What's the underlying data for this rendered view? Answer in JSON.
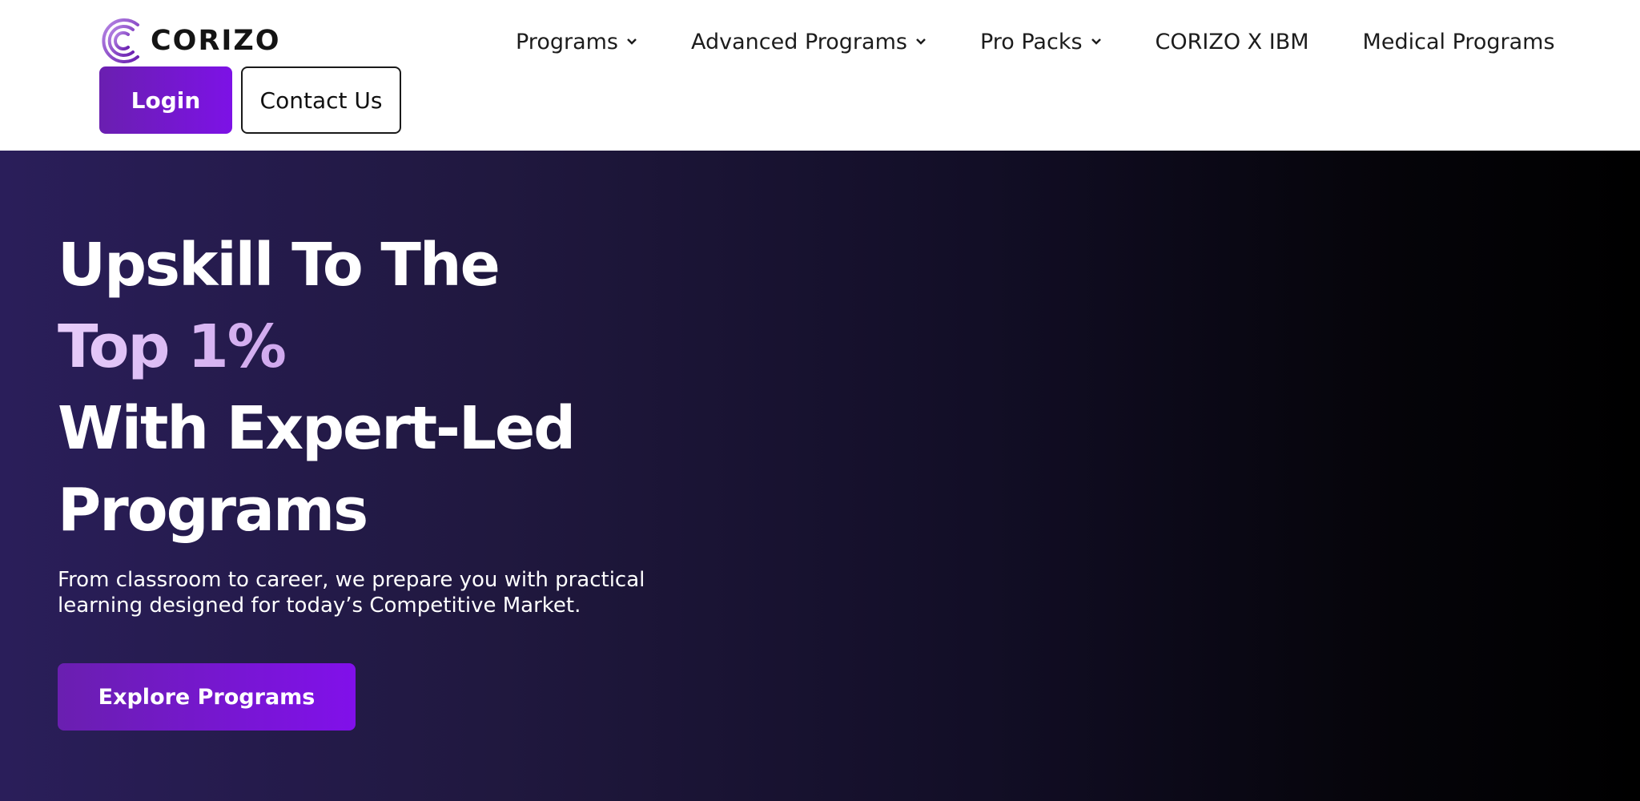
{
  "brand": {
    "name": "CORIZO",
    "accent_color": "#7d12e6"
  },
  "nav": {
    "items": [
      {
        "label": "Programs",
        "has_dropdown": true
      },
      {
        "label": "Advanced Programs",
        "has_dropdown": true
      },
      {
        "label": "Pro Packs",
        "has_dropdown": true
      },
      {
        "label": "CORIZO X IBM",
        "has_dropdown": false
      },
      {
        "label": "Medical Programs",
        "has_dropdown": false
      }
    ]
  },
  "header_actions": {
    "login_label": "Login",
    "contact_label": "Contact Us"
  },
  "hero": {
    "title_line_1": "Upskill To The",
    "title_highlight": "Top 1%",
    "title_line_3": "With Expert-Led",
    "title_line_4": "Programs",
    "subtitle_line_1": "From classroom to career, we prepare you with practical",
    "subtitle_line_2": "learning designed for today’s Competitive Market.",
    "cta_label": "Explore Programs",
    "background_start": "#2a1e5a",
    "background_end": "#000000"
  }
}
